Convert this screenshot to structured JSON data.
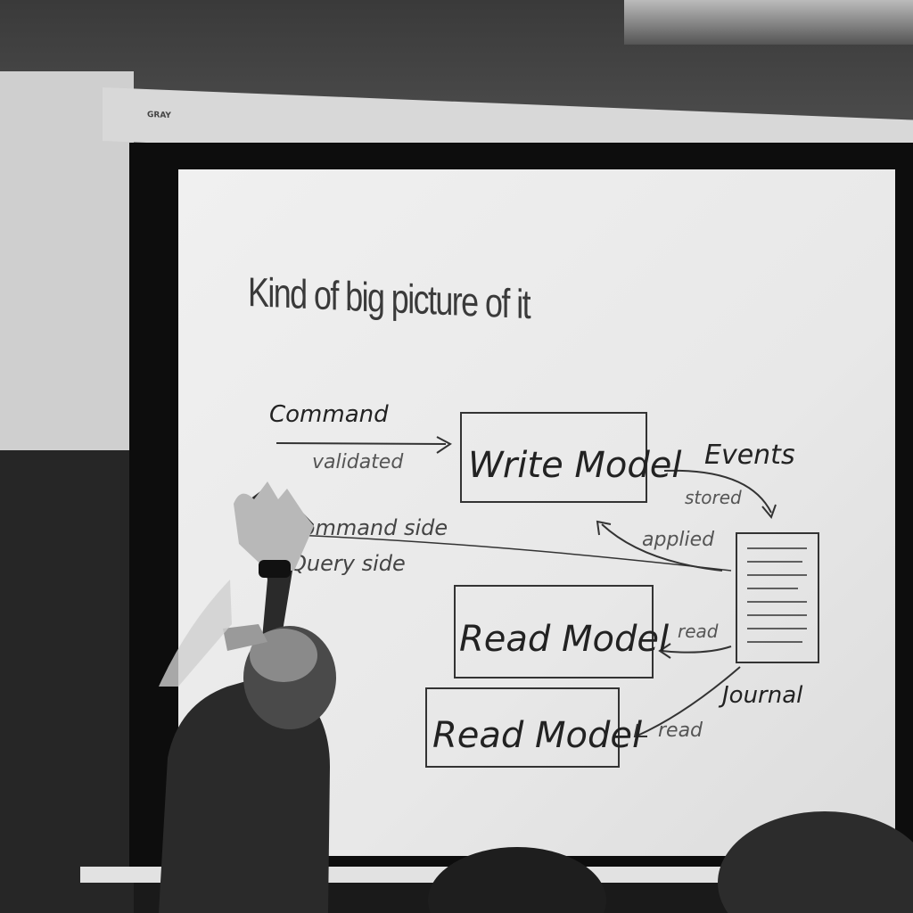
{
  "projector": {
    "brand": "GRAY"
  },
  "slide": {
    "title": "Kind of big picture of it",
    "labels": {
      "command": "Command",
      "validated": "validated",
      "write_model": "Write Model",
      "events": "Events",
      "stored": "stored",
      "applied": "applied",
      "command_side": "Command side",
      "query_side": "Query side",
      "read_model_1": "Read Model",
      "read_model_2": "Read Model",
      "read_1": "read",
      "read_2": "read",
      "journal": "Journal"
    }
  }
}
